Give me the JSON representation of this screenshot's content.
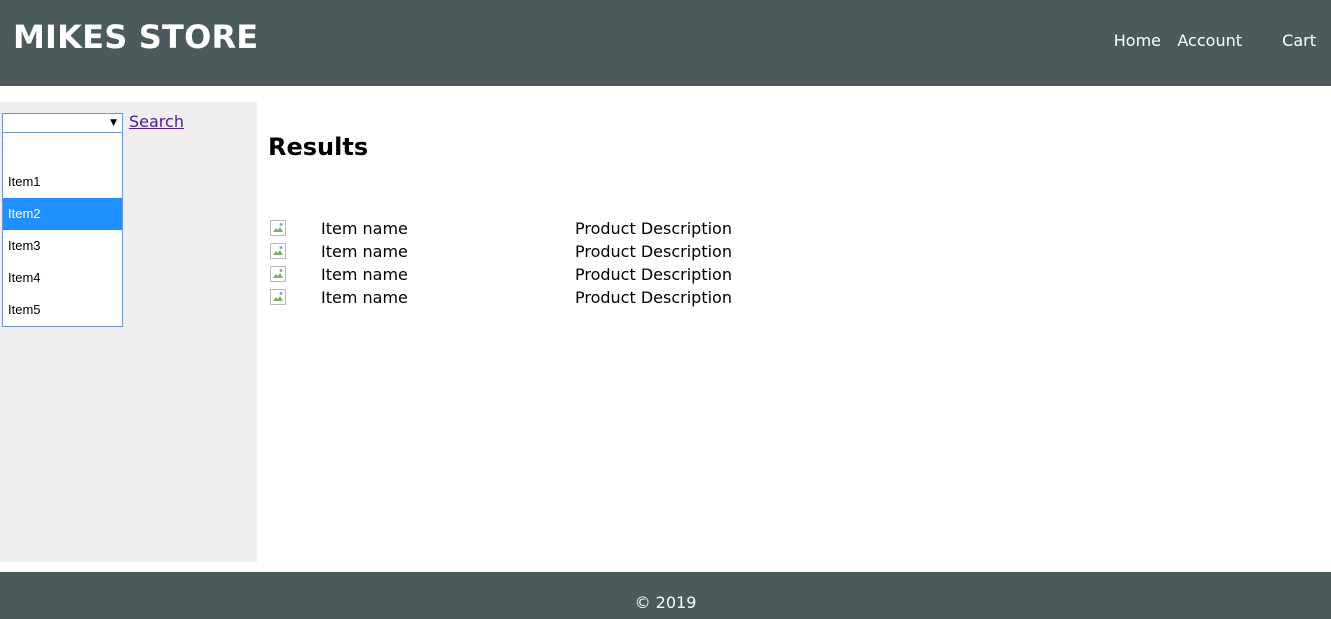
{
  "header": {
    "title": "MIKES STORE",
    "nav": [
      "Home",
      "Account",
      "Cart"
    ]
  },
  "sidebar": {
    "select_value": "",
    "options": [
      "",
      "Item1",
      "Item2",
      "Item3",
      "Item4",
      "Item5"
    ],
    "highlighted_option": "Item2",
    "search_label": "Search"
  },
  "main": {
    "title": "Results",
    "rows": [
      {
        "image": "broken-image-icon",
        "name": "Item name",
        "description": "Product Description"
      },
      {
        "image": "broken-image-icon",
        "name": "Item name",
        "description": "Product Description"
      },
      {
        "image": "broken-image-icon",
        "name": "Item name",
        "description": "Product Description"
      },
      {
        "image": "broken-image-icon",
        "name": "Item name",
        "description": "Product Description"
      }
    ]
  },
  "footer": {
    "text": "© 2019"
  },
  "colors": {
    "bar": "#4b5a5a",
    "sidebar_bg": "#eeeeee",
    "selected_option": "#1e90ff",
    "visited_link": "#551a8b"
  }
}
